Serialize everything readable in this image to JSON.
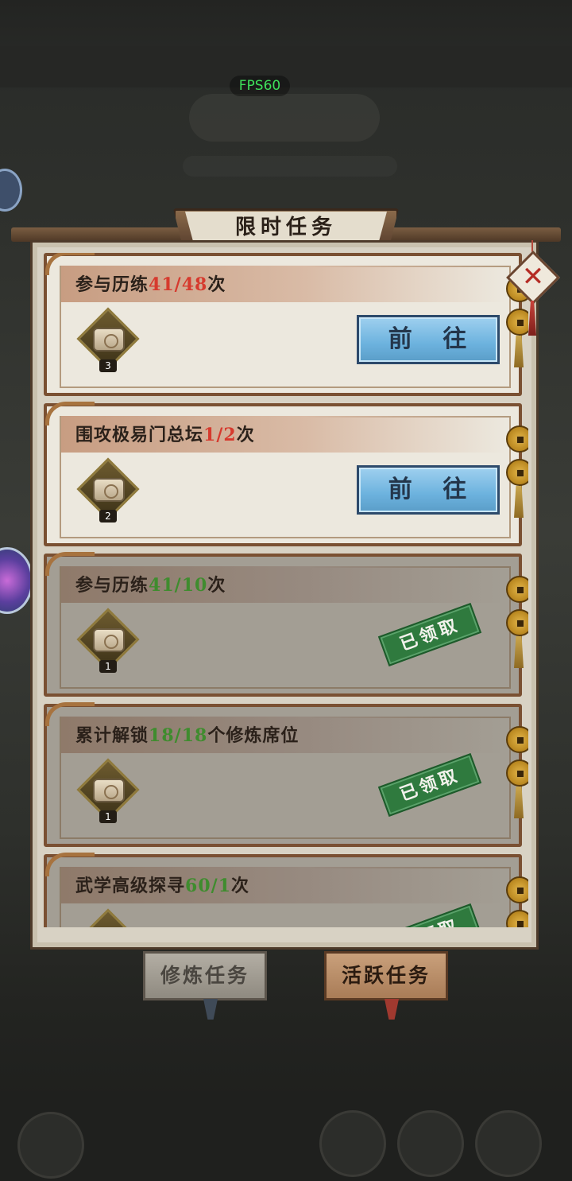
{
  "overlay": {
    "fps": "FPS60"
  },
  "dialog": {
    "title": "限时任务"
  },
  "tasks": [
    {
      "name": "参与历练",
      "current": "41",
      "total": "48",
      "unit": "次",
      "progress_color": "red",
      "reward_count": "3",
      "action": {
        "type": "go",
        "label": "前 往"
      }
    },
    {
      "name": "围攻极易门总坛",
      "current": "1",
      "total": "2",
      "unit": "次",
      "progress_color": "red",
      "reward_count": "2",
      "action": {
        "type": "go",
        "label": "前 往"
      }
    },
    {
      "name": "参与历练",
      "current": "41",
      "total": "10",
      "unit": "次",
      "progress_color": "green",
      "reward_count": "1",
      "action": {
        "type": "claimed",
        "label": "已领取"
      }
    },
    {
      "name": "累计解锁",
      "current": "18",
      "total": "18",
      "unit": "个修炼席位",
      "progress_color": "green",
      "reward_count": "1",
      "action": {
        "type": "claimed",
        "label": "已领取"
      }
    },
    {
      "name": "武学高级探寻",
      "current": "60",
      "total": "1",
      "unit": "次",
      "progress_color": "green",
      "reward_count": "",
      "action": {
        "type": "claimed",
        "label": "已领取"
      }
    }
  ],
  "tabs": [
    {
      "label": "修炼任务",
      "active": false
    },
    {
      "label": "活跃任务",
      "active": true
    }
  ],
  "colors": {
    "progress_red": "#d63a2e",
    "progress_green": "#3f8c2e",
    "go_button": "#6cb2de",
    "claimed_stamp": "#2f7a3e"
  },
  "icons": {
    "close": "x-mark-icon",
    "reward": "scroll-icon",
    "coin": "coin-icon"
  }
}
